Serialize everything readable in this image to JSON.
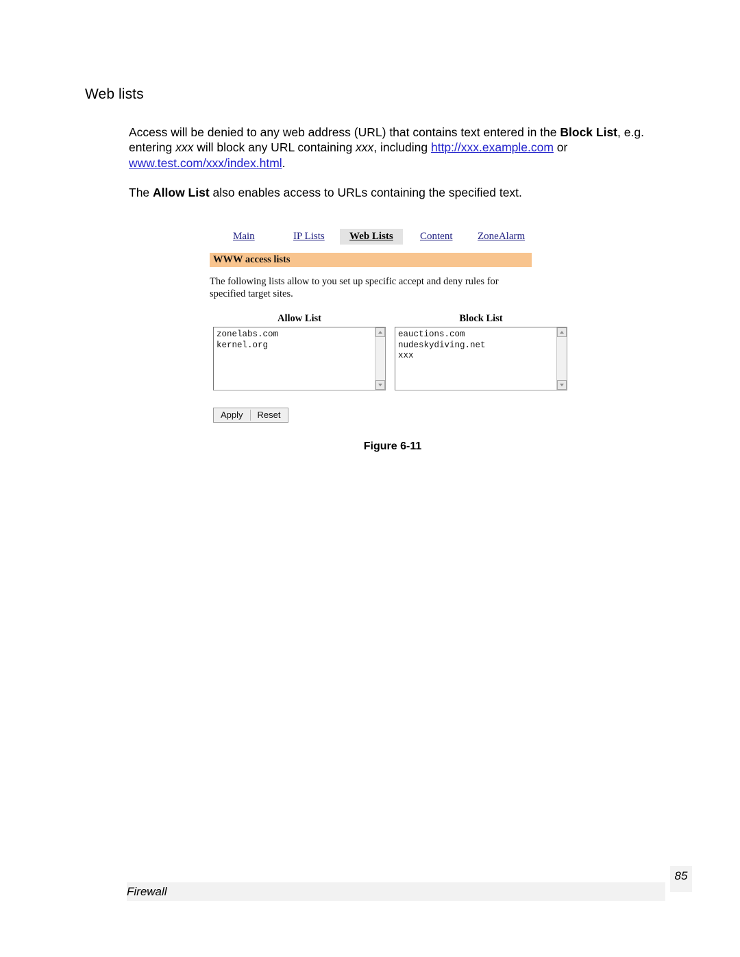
{
  "document": {
    "heading": "Web lists",
    "paragraph1": {
      "part1": "Access will be denied to any web address (URL) that contains text entered in the ",
      "bold1": "Block List",
      "part2": ", e.g. entering ",
      "italic1": "xxx",
      "part3": " will block any URL containing ",
      "italic2": "xxx",
      "part4": ", including ",
      "link1": "http://xxx.example.com",
      "part5": " or ",
      "link2": "www.test.com/xxx/index.html",
      "part6": "."
    },
    "paragraph2": {
      "part1": "The ",
      "bold1": "Allow List",
      "part2": " also enables access to URLs containing the specified text."
    },
    "figure_caption": "Figure 6-11"
  },
  "figure": {
    "tabs": [
      {
        "label": "Main",
        "active": false
      },
      {
        "label": "IP Lists",
        "active": false
      },
      {
        "label": "Web Lists",
        "active": true
      },
      {
        "label": "Content",
        "active": false
      },
      {
        "label": "ZoneAlarm",
        "active": false
      }
    ],
    "section_title": "WWW access lists",
    "description": "The following lists allow to you set up specific accept and deny rules for specified target sites.",
    "allow_list": {
      "label": "Allow List",
      "value": "zonelabs.com\nkernel.org"
    },
    "block_list": {
      "label": "Block List",
      "value": "eauctions.com\nnudeskydiving.net\nxxx"
    },
    "buttons": {
      "apply": "Apply",
      "reset": "Reset"
    },
    "colors": {
      "section_band": "#f8c48e",
      "active_tab_bg": "#e3e3e3",
      "link": "#202082"
    }
  },
  "footer": {
    "section_label": "Firewall",
    "page_number": "85"
  }
}
